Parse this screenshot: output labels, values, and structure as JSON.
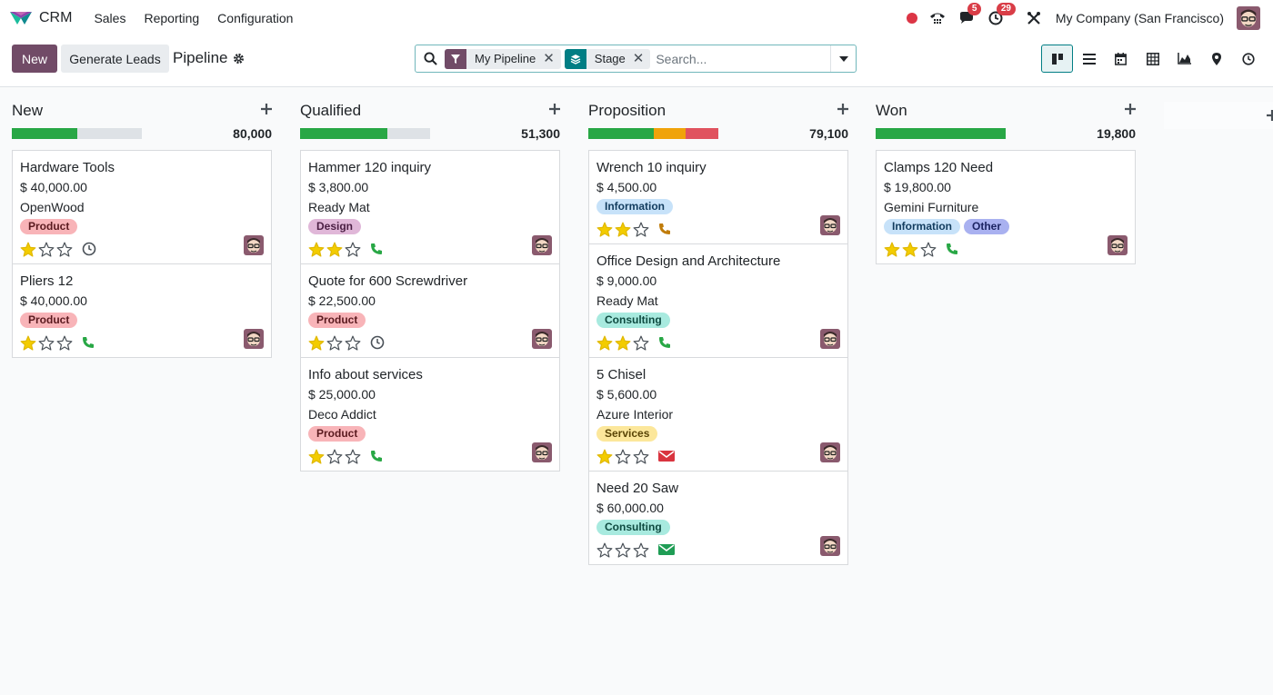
{
  "app": {
    "name": "CRM",
    "menus": [
      "Sales",
      "Reporting",
      "Configuration"
    ],
    "company": "My Company (San Francisco)",
    "chat_count": "5",
    "activity_count": "29"
  },
  "control": {
    "new_label": "New",
    "generate_label": "Generate Leads",
    "breadcrumb": "Pipeline",
    "facets": [
      "My Pipeline",
      "Stage"
    ],
    "search_placeholder": "Search..."
  },
  "colors": {
    "brand": "#714b67",
    "accent": "#017e84",
    "green": "#28a745",
    "orange": "#f0a30a",
    "red": "#e0525e",
    "grey": "#dee2e6"
  },
  "columns": [
    {
      "title": "New",
      "total": "80,000",
      "progress": {
        "green": 0.5,
        "orange": 0,
        "red": 0
      },
      "cards": [
        {
          "title": "Hardware Tools",
          "amount": "$ 40,000.00",
          "partner": "OpenWood",
          "tags": [
            {
              "label": "Product",
              "bg": "#f8b4b8",
              "fg": "#5a1a1f"
            }
          ],
          "stars": 1,
          "activity": "clock-icon"
        },
        {
          "title": "Pliers 12",
          "amount": "$ 40,000.00",
          "partner": "",
          "tags": [
            {
              "label": "Product",
              "bg": "#f8b4b8",
              "fg": "#5a1a1f"
            }
          ],
          "stars": 1,
          "activity": "phone-icon-green"
        }
      ]
    },
    {
      "title": "Qualified",
      "total": "51,300",
      "progress": {
        "green": 0.67,
        "orange": 0,
        "red": 0
      },
      "cards": [
        {
          "title": "Hammer 120 inquiry",
          "amount": "$ 3,800.00",
          "partner": "Ready Mat",
          "tags": [
            {
              "label": "Design",
              "bg": "#e0b7d8",
              "fg": "#4a1e43"
            }
          ],
          "stars": 2,
          "activity": "phone-icon-green"
        },
        {
          "title": "Quote for 600 Screwdriver",
          "amount": "$ 22,500.00",
          "partner": "",
          "tags": [
            {
              "label": "Product",
              "bg": "#f8b4b8",
              "fg": "#5a1a1f"
            }
          ],
          "stars": 1,
          "activity": "clock-icon"
        },
        {
          "title": "Info about services",
          "amount": "$ 25,000.00",
          "partner": "Deco Addict",
          "tags": [
            {
              "label": "Product",
              "bg": "#f8b4b8",
              "fg": "#5a1a1f"
            }
          ],
          "stars": 1,
          "activity": "phone-icon-green"
        }
      ]
    },
    {
      "title": "Proposition",
      "total": "79,100",
      "progress": {
        "green": 0.5,
        "orange": 0.25,
        "red": 0.25
      },
      "cards": [
        {
          "title": "Wrench 10 inquiry",
          "amount": "$ 4,500.00",
          "partner": "",
          "tags": [
            {
              "label": "Information",
              "bg": "#c7e2f9",
              "fg": "#123c5e"
            }
          ],
          "stars": 2,
          "activity": "phone-icon-orange"
        },
        {
          "title": "Office Design and Architecture",
          "amount": "$ 9,000.00",
          "partner": "Ready Mat",
          "tags": [
            {
              "label": "Consulting",
              "bg": "#a8eadf",
              "fg": "#0e4a40"
            }
          ],
          "stars": 2,
          "activity": "phone-icon-green"
        },
        {
          "title": "5 Chisel",
          "amount": "$ 5,600.00",
          "partner": "Azure Interior",
          "tags": [
            {
              "label": "Services",
              "bg": "#fce79b",
              "fg": "#5a4506"
            }
          ],
          "stars": 1,
          "activity": "mail-icon-red"
        },
        {
          "title": "Need 20 Saw",
          "amount": "$ 60,000.00",
          "partner": "",
          "tags": [
            {
              "label": "Consulting",
              "bg": "#a8eadf",
              "fg": "#0e4a40"
            }
          ],
          "stars": 0,
          "activity": "mail-icon-green"
        }
      ]
    },
    {
      "title": "Won",
      "total": "19,800",
      "progress": {
        "green": 1,
        "orange": 0,
        "red": 0
      },
      "cards": [
        {
          "title": "Clamps 120 Need",
          "amount": "$ 19,800.00",
          "partner": "Gemini Furniture",
          "tags": [
            {
              "label": "Information",
              "bg": "#c7e2f9",
              "fg": "#123c5e"
            },
            {
              "label": "Other",
              "bg": "#a9b1f0",
              "fg": "#1c2463"
            }
          ],
          "stars": 2,
          "activity": "phone-icon-green"
        }
      ]
    }
  ]
}
